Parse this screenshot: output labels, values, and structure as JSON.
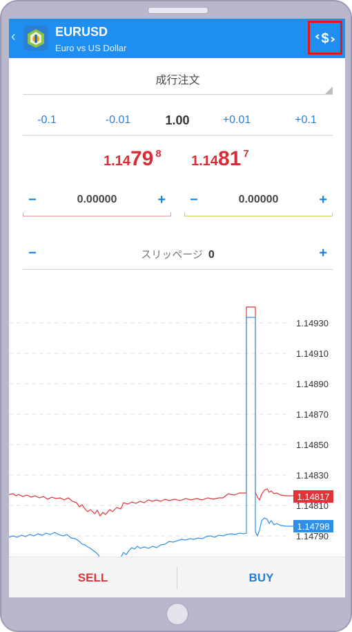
{
  "header": {
    "back_icon": "chevron-left-icon",
    "logo_icon": "metatrader-logo-icon",
    "symbol": "EURUSD",
    "description": "Euro vs US Dollar",
    "swap_icon": "currency-swap-icon",
    "bg_color": "#1e8ef0"
  },
  "order": {
    "type": "成行注文",
    "volume_steps": [
      "-0.1",
      "-0.01",
      "1.00",
      "+0.01",
      "+0.1"
    ],
    "bid": {
      "prefix": "1.14",
      "big": "79",
      "sup": "8"
    },
    "ask": {
      "prefix": "1.14",
      "big": "81",
      "sup": "7"
    },
    "stop_loss": {
      "minus": "−",
      "value": "0.00000",
      "plus": "+"
    },
    "take_profit": {
      "minus": "−",
      "value": "0.00000",
      "plus": "+"
    },
    "slippage": {
      "minus": "−",
      "label": "スリッページ",
      "value": "0",
      "plus": "+"
    }
  },
  "chart_data": {
    "type": "line",
    "series": [
      {
        "color": "#e0333a",
        "last": "1.14817"
      },
      {
        "color": "#2e8fe8",
        "last": "1.14798"
      }
    ],
    "y_ticks": [
      "1.14930",
      "1.14910",
      "1.14890",
      "1.14870",
      "1.14850",
      "1.14830",
      "1.14810",
      "1.14790"
    ],
    "ask_label": "1.14817",
    "bid_label": "1.14798",
    "grid": true
  },
  "footer": {
    "sell": "SELL",
    "buy": "BUY"
  },
  "colors": {
    "sell": "#e0333a",
    "buy": "#1e7fd6",
    "accent": "#1e8ef0"
  }
}
